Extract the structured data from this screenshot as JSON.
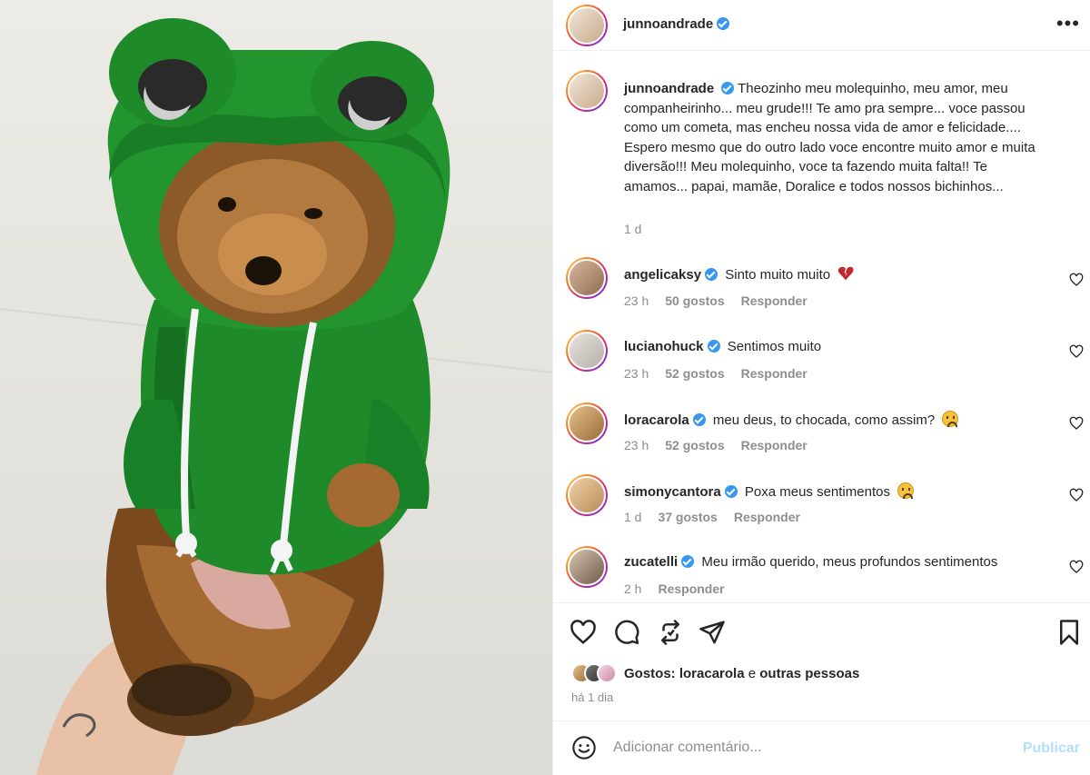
{
  "header": {
    "username": "junnoandrade",
    "more_label": "•••"
  },
  "caption": {
    "username": "junnoandrade",
    "text": "Theozinho meu molequinho, meu amor, meu companheirinho... meu grude!!! Te amo pra sempre... voce passou como um cometa, mas encheu nossa vida de amor e felicidade.... Espero mesmo que do outro lado voce encontre muito amor e muita diversão!!! Meu molequinho, voce ta fazendo muita falta!! Te amamos... papai, mamãe, Doralice e todos nossos bichinhos...",
    "time": "1 d"
  },
  "comments": [
    {
      "username": "angelicaksy",
      "text": "Sinto muito muito",
      "emoji": "broken-heart",
      "time": "23 h",
      "likes": "50 gostos",
      "reply": "Responder"
    },
    {
      "username": "lucianohuck",
      "text": "Sentimos muito",
      "emoji": "",
      "time": "23 h",
      "likes": "52 gostos",
      "reply": "Responder"
    },
    {
      "username": "loracarola",
      "text": "meu deus, to chocada, como assim?",
      "emoji": "sad-face",
      "time": "23 h",
      "likes": "52 gostos",
      "reply": "Responder"
    },
    {
      "username": "simonycantora",
      "text": "Poxa meus sentimentos",
      "emoji": "sad-face",
      "time": "1 d",
      "likes": "37 gostos",
      "reply": "Responder"
    },
    {
      "username": "zucatelli",
      "text": "Meu irmão querido, meus profundos sentimentos",
      "emoji": "",
      "time": "2 h",
      "likes": "",
      "reply": "Responder"
    }
  ],
  "likes": {
    "prefix": "Gostos:",
    "user": "loracarola",
    "joiner": "e",
    "others": "outras pessoas"
  },
  "posted": "há 1 dia",
  "add_comment": {
    "placeholder": "Adicionar comentário...",
    "publish_label": "Publicar"
  },
  "icons": [
    "heart-icon",
    "comment-icon",
    "repost-icon",
    "share-icon",
    "bookmark-icon",
    "smile-icon",
    "verified-icon"
  ],
  "colors": {
    "verified": "#3897f0",
    "publish": "#b2dffc",
    "muted": "#8e8e8e"
  }
}
